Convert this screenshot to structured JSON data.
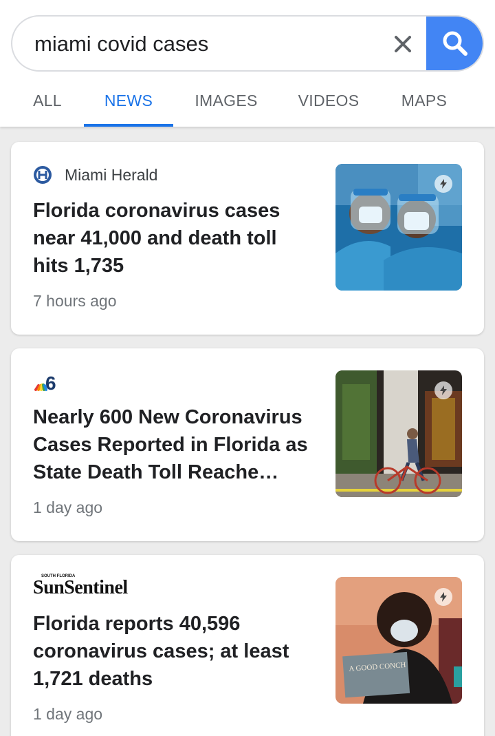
{
  "search": {
    "query": "miami covid cases"
  },
  "tabs": [
    {
      "label": "ALL",
      "active": false
    },
    {
      "label": "NEWS",
      "active": true
    },
    {
      "label": "IMAGES",
      "active": false
    },
    {
      "label": "VIDEOS",
      "active": false
    },
    {
      "label": "MAPS",
      "active": false
    }
  ],
  "colors": {
    "accent": "#1a73e8",
    "search_button": "#4285f4"
  },
  "articles": [
    {
      "source": "Miami Herald",
      "source_icon": "miami-herald-logo",
      "headline": "Florida coronavirus cases near 41,000 and death toll hits 1,735",
      "time": "7 hours ago",
      "thumbnail": "healthcare-workers-in-face-shields",
      "amp": true
    },
    {
      "source": "",
      "source_icon": "nbc6-logo",
      "headline": "Nearly 600 New Coronavirus Cases Reported in Florida as State Death Toll Reache…",
      "time": "1 day ago",
      "thumbnail": "cyclist-on-street",
      "amp": true
    },
    {
      "source": "SunSentinel",
      "source_label_small": "SOUTH FLORIDA",
      "source_icon": "sun-sentinel-logo",
      "headline": "Florida reports 40,596 coronavirus cases; at least 1,721 deaths",
      "time": "1 day ago",
      "thumbnail": "person-in-mask-with-sign",
      "sign_text": "A GOOD CONCH",
      "amp": true
    }
  ]
}
